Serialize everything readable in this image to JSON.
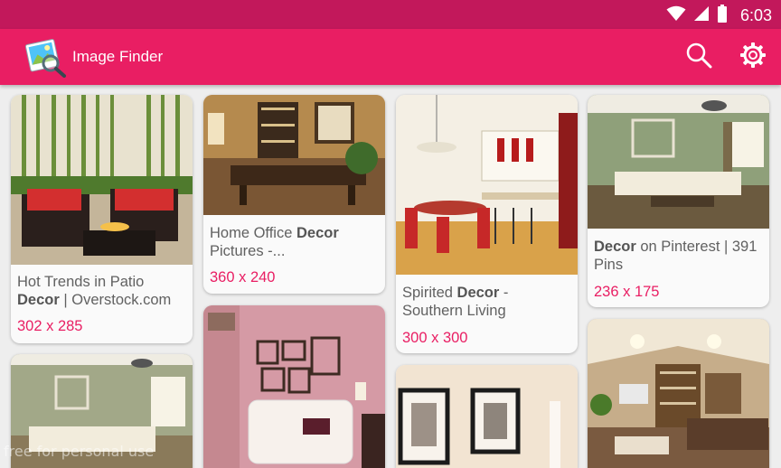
{
  "status_bar": {
    "time": "6:03",
    "icons": [
      "wifi-icon",
      "signal-icon",
      "battery-icon"
    ]
  },
  "app_bar": {
    "title": "Image Finder",
    "actions": [
      "search-icon",
      "settings-gear-icon"
    ]
  },
  "colors": {
    "status_bar": "#c2185b",
    "primary": "#e91e63",
    "accent_text": "#e91e63",
    "background": "#eeeeee",
    "card": "#fafafa"
  },
  "results": [
    {
      "caption_pre": "Hot Trends in Patio",
      "caption_bold": "Decor",
      "caption_post": " | Overstock.com",
      "dims": "302 x 285"
    },
    {
      "caption_pre": "Home Office ",
      "caption_bold": "Decor",
      "caption_post": " Pictures -...",
      "dims": "360 x 240"
    },
    {
      "caption_pre": "Spirited ",
      "caption_bold": "Decor",
      "caption_post": " - Southern Living",
      "dims": "300 x 300"
    },
    {
      "caption_pre": "",
      "caption_bold": "Decor",
      "caption_post": " on Pinterest | 391 Pins",
      "dims": "236 x 175"
    },
    {
      "caption_pre": "",
      "caption_bold": "",
      "caption_post": "",
      "dims": ""
    },
    {
      "caption_pre": "",
      "caption_bold": "",
      "caption_post": "",
      "dims": ""
    },
    {
      "caption_pre": "",
      "caption_bold": "",
      "caption_post": "",
      "dims": ""
    },
    {
      "caption_pre": "",
      "caption_bold": "",
      "caption_post": "",
      "dims": ""
    }
  ],
  "watermark": "free for personal use"
}
